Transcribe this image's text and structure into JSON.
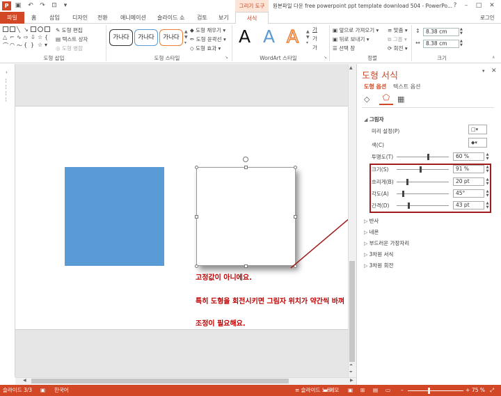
{
  "window": {
    "app_icon": "P",
    "context_group": "그리기 도구",
    "title": "원본파일 다운 free powerpoint ppt template download 504 - PowerPo...",
    "controls": [
      "?",
      "–",
      "□",
      "✕"
    ]
  },
  "qat": {
    "icons": [
      "save-icon",
      "undo-icon",
      "redo-icon",
      "start-icon",
      "customize-icon"
    ]
  },
  "tabs": {
    "file": "파일",
    "items": [
      "홈",
      "삽입",
      "디자인",
      "전환",
      "애니메이션",
      "슬라이드 쇼",
      "검토",
      "보기"
    ],
    "active": "서식",
    "login": "로그인"
  },
  "ribbon": {
    "groups": [
      "도형 삽입",
      "도형 스타일",
      "WordArt 스타일",
      "정렬",
      "크기"
    ],
    "insert_shapes": {
      "edit_shape": "도형 편집",
      "text_box": "텍스트 상자",
      "merge_shapes": "도형 병합"
    },
    "shape_styles": {
      "samples": [
        "가나다",
        "가나다",
        "가나다"
      ],
      "fill": "도형 채우기",
      "outline": "도형 윤곽선",
      "effects": "도형 효과"
    },
    "wordart": {
      "letters": [
        "A",
        "A",
        "A"
      ],
      "side": [
        "가",
        "가",
        "가"
      ]
    },
    "arrange": {
      "bring_forward": "앞으로 가져오기",
      "send_backward": "뒤로 보내기",
      "selection_pane": "선택 창",
      "align": "맞춤",
      "group": "그룹",
      "rotate": "회전"
    },
    "size": {
      "height": "8.38 cm",
      "width": "8.38 cm"
    }
  },
  "annotation": {
    "line1": "고정값이 아니에요.",
    "line2": "특히 도형을 회전시키면 그림자 위치가 약간씩 바껴",
    "line3": "조정이 필요해요."
  },
  "pane": {
    "title": "도형 서식",
    "tab_shape": "도형 옵션",
    "tab_text": "텍스트 옵션",
    "shadow_section": "그림자",
    "preset_label": "미리 설정(P)",
    "color_label": "색(C)",
    "transparency": {
      "label": "투명도(T)",
      "value": "60 %",
      "level": 0.6
    },
    "size": {
      "label": "크기(S)",
      "value": "91 %",
      "level": 0.45
    },
    "blur": {
      "label": "흐리게(B)",
      "value": "20 pt",
      "level": 0.2
    },
    "angle": {
      "label": "각도(A)",
      "value": "45°",
      "level": 0.12
    },
    "distance": {
      "label": "간격(D)",
      "value": "43 pt",
      "level": 0.22
    },
    "sections": [
      "반사",
      "네온",
      "부드러운 가장자리",
      "3차원 서식",
      "3차원 회전"
    ]
  },
  "status": {
    "slide": "슬라이드 3/3",
    "language": "한국어",
    "notes": "슬라이드 노트",
    "comments": "메모",
    "zoom": "75 %"
  },
  "colors": {
    "accent": "#d24726",
    "shape_fill": "#5b9bd5",
    "annotation": "#c00000",
    "highlight_box": "#a01b1b"
  }
}
